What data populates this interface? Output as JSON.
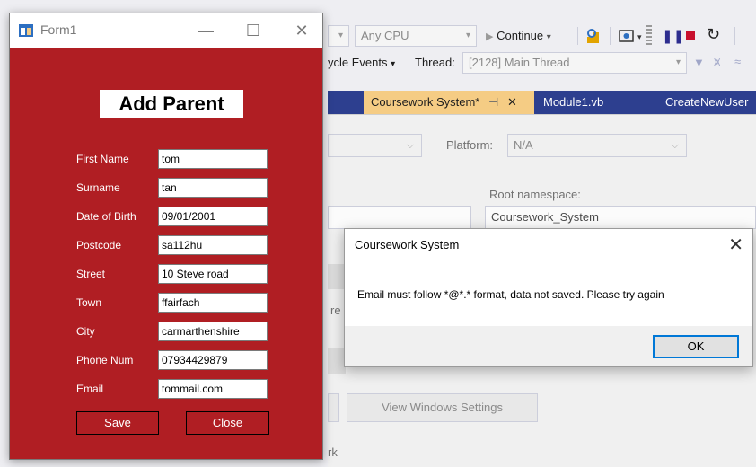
{
  "vs": {
    "toolbar": {
      "platform_combo": "Any CPU",
      "continue_label": "Continue",
      "lifecycle_label": "ycle Events",
      "thread_label": "Thread:",
      "thread_combo": "[2128] Main Thread"
    },
    "tabs": [
      {
        "label": "Coursework System*"
      },
      {
        "label": "Module1.vb"
      },
      {
        "label": "CreateNewUser"
      }
    ],
    "content": {
      "platform_label": "Platform:",
      "platform_value": "N/A",
      "root_ns_label": "Root namespace:",
      "root_ns_value": "Coursework_System",
      "view_windows_settings": "View Windows Settings",
      "partial_rk": "rk",
      "partial_re": "re"
    }
  },
  "form1": {
    "title": "Form1",
    "heading": "Add Parent",
    "fields": [
      {
        "label": "First Name",
        "value": "tom"
      },
      {
        "label": "Surname",
        "value": "tan"
      },
      {
        "label": "Date of Birth",
        "value": "09/01/2001"
      },
      {
        "label": "Postcode",
        "value": "sa112hu"
      },
      {
        "label": "Street",
        "value": "10 Steve road"
      },
      {
        "label": "Town",
        "value": "ffairfach"
      },
      {
        "label": "City",
        "value": "carmarthenshire"
      },
      {
        "label": "Phone Num",
        "value": "07934429879"
      },
      {
        "label": "Email",
        "value": "tommail.com"
      }
    ],
    "save_label": "Save",
    "close_label": "Close"
  },
  "msgbox": {
    "title": "Coursework System",
    "message": "Email must follow *@*.* format, data not saved. Please try again",
    "ok_label": "OK"
  },
  "colors": {
    "form_bg": "#b01e23",
    "vs_tab_bar": "#2d3f8f",
    "vs_active_tab": "#f5cc84",
    "ok_border": "#0078d7"
  }
}
